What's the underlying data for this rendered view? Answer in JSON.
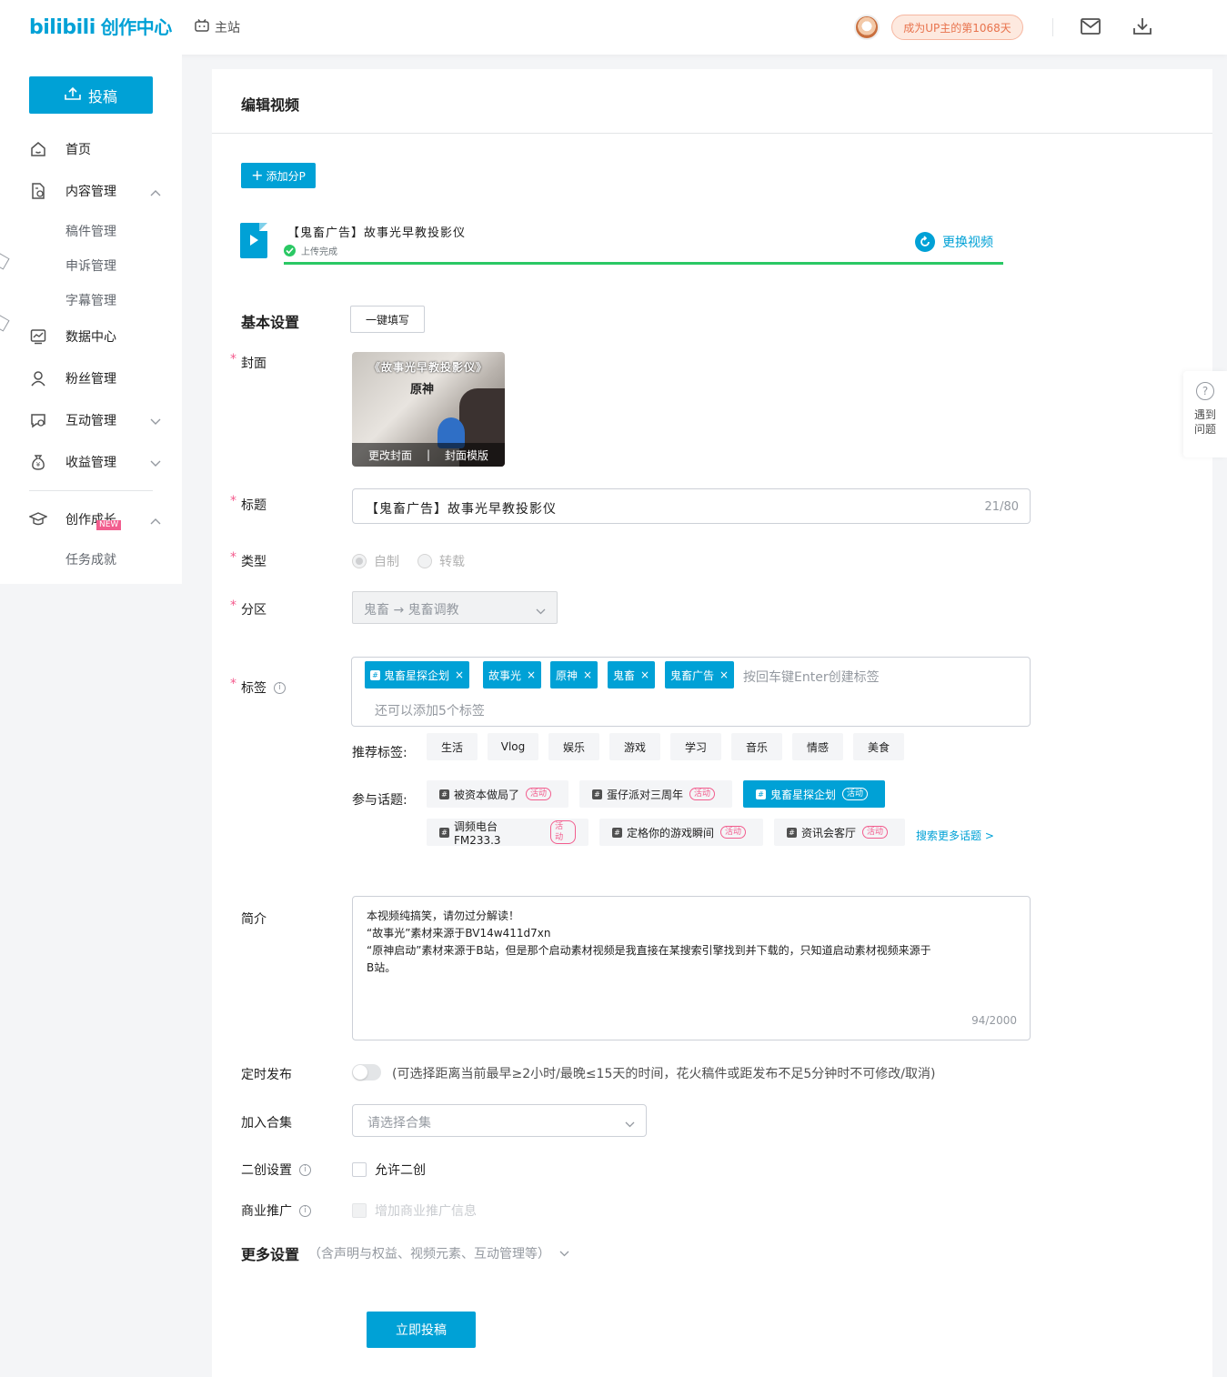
{
  "header": {
    "logo_brand": "bilibili",
    "logo_product": "创作中心",
    "main_site": "主站",
    "up_days": "成为UP主的第1068天"
  },
  "sidebar": {
    "post_button": "投稿",
    "items": [
      {
        "label": "首页",
        "icon": "home-icon"
      },
      {
        "label": "内容管理",
        "icon": "content-icon",
        "expanded": true
      },
      {
        "label": "稿件管理"
      },
      {
        "label": "申诉管理"
      },
      {
        "label": "字幕管理"
      },
      {
        "label": "数据中心",
        "icon": "chart-icon"
      },
      {
        "label": "粉丝管理",
        "icon": "user-icon"
      },
      {
        "label": "互动管理",
        "icon": "chat-icon",
        "expanded": false
      },
      {
        "label": "收益管理",
        "icon": "money-icon",
        "expanded": false
      },
      {
        "label": "创作成长",
        "icon": "graduation-icon",
        "expanded": true
      },
      {
        "label": "任务成就"
      }
    ],
    "new_badge": "NEW"
  },
  "main": {
    "title": "编辑视频",
    "add_part": "添加分P",
    "file": {
      "name": "【鬼畜广告】故事光早教投影仪",
      "status": "上传完成",
      "progress": 1.0,
      "replace": "更换视频"
    },
    "basic_settings": "基本设置",
    "one_click_fill": "一键填写",
    "cover": {
      "label": "封面",
      "image_title": "《故事光早教投影仪》",
      "image_subtitle": "原神",
      "change": "更改封面",
      "template": "封面模版"
    },
    "title_field": {
      "label": "标题",
      "value": "【鬼畜广告】故事光早教投影仪",
      "count": "21/80"
    },
    "type": {
      "label": "类型",
      "options": [
        "自制",
        "转载"
      ],
      "selected": "自制"
    },
    "zone": {
      "label": "分区",
      "value": "鬼畜 → 鬼畜调教"
    },
    "tags": {
      "label": "标签",
      "items": [
        "鬼畜星探企划",
        "故事光",
        "原神",
        "鬼畜",
        "鬼畜广告"
      ],
      "placeholder": "按回车键Enter创建标签",
      "remaining": "还可以添加5个标签"
    },
    "recommended": {
      "label": "推荐标签:",
      "items": [
        "生活",
        "Vlog",
        "娱乐",
        "游戏",
        "学习",
        "音乐",
        "情感",
        "美食"
      ]
    },
    "topics": {
      "label": "参与话题:",
      "activity_badge": "活动",
      "items": [
        "被资本做局了",
        "蛋仔派对三周年",
        "鬼畜星探企划",
        "调频电台FM233.3",
        "定格你的游戏瞬间",
        "资讯会客厅"
      ],
      "active": "鬼畜星探企划",
      "search_more": "搜索更多话题 >"
    },
    "description": {
      "label": "简介",
      "lines": [
        "本视频纯搞笑，请勿过分解读！",
        "“故事光”素材来源于BV14w411d7xn",
        "“原神启动”素材来源于B站，但是那个启动素材视频是我直接在某搜索引擎找到并下载的，只知道启动素材视频来源于",
        "B站。"
      ],
      "count": "94/2000"
    },
    "schedule": {
      "label": "定时发布",
      "enabled": false,
      "note": "(可选择距离当前最早≥2小时/最晚≤15天的时间，花火稿件或距发布不足5分钟时不可修改/取消)"
    },
    "collection": {
      "label": "加入合集",
      "placeholder": "请选择合集"
    },
    "derivative": {
      "label": "二创设置",
      "option": "允许二创"
    },
    "commercial": {
      "label": "商业推广",
      "option": "增加商业推广信息"
    },
    "more_settings": {
      "title": "更多设置",
      "subtitle": "（含声明与权益、视频元素、互动管理等）"
    },
    "submit": "立即投稿"
  },
  "help": {
    "text": "遇到问题"
  },
  "colors": {
    "accent": "#00a1d6",
    "success": "#2ac864",
    "required": "#f45a8d"
  }
}
